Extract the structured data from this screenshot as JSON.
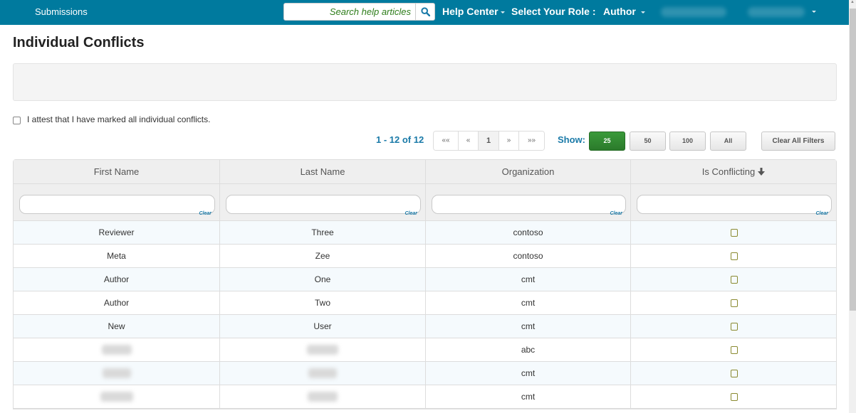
{
  "navbar": {
    "submissions_label": "Submissions",
    "search_placeholder": "Search help articles",
    "search_icon": "search-icon",
    "help_center_label": "Help Center",
    "select_role_label": "Select Your Role :",
    "role_value": "Author"
  },
  "page": {
    "title": "Individual Conflicts",
    "attest_label": "I attest that I have marked all individual conflicts."
  },
  "pager": {
    "count_text": "1 - 12 of 12",
    "first": "««",
    "prev": "«",
    "current": "1",
    "next": "»",
    "last": "»»",
    "show_label": "Show:",
    "page_sizes": [
      "25",
      "50",
      "100",
      "All"
    ],
    "selected_page_size": "25",
    "clear_all_label": "Clear All Filters"
  },
  "table": {
    "columns": [
      "First Name",
      "Last Name",
      "Organization",
      "Is Conflicting"
    ],
    "sort_column": "Is Conflicting",
    "sort_direction": "descending",
    "clear_label": "Clear",
    "highlight_color": "#ffff00",
    "rows": [
      {
        "first": "Reviewer",
        "last": "Three",
        "org": "contoso",
        "conflicting": false
      },
      {
        "first": "Meta",
        "last": "Zee",
        "org": "contoso",
        "conflicting": false
      },
      {
        "first": "Author",
        "last": "One",
        "org": "cmt",
        "conflicting": false
      },
      {
        "first": "Author",
        "last": "Two",
        "org": "cmt",
        "conflicting": false
      },
      {
        "first": "New",
        "last": "User",
        "org": "cmt",
        "conflicting": false
      },
      {
        "first": "[redacted]",
        "last": "[redacted]",
        "org": "abc",
        "conflicting": false
      },
      {
        "first": "[redacted]",
        "last": "[redacted]",
        "org": "cmt",
        "conflicting": false
      },
      {
        "first": "[redacted]",
        "last": "[redacted]",
        "org": "cmt",
        "conflicting": false
      }
    ]
  },
  "colors": {
    "navbar": "#007a9e",
    "accent_text": "#1a7aa8",
    "active_page_size": "#2b7a2b",
    "search_text": "#2e7d1a"
  }
}
